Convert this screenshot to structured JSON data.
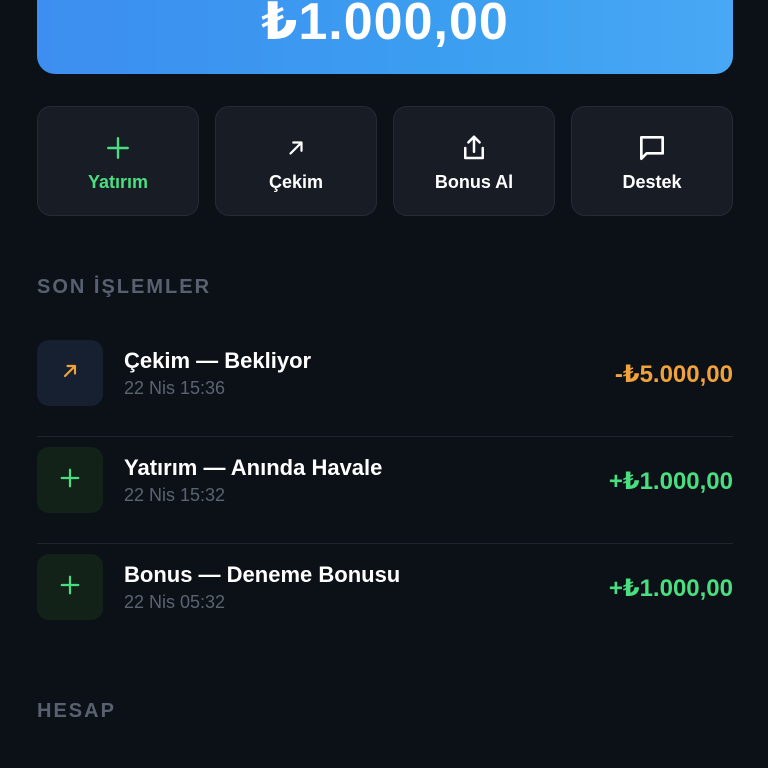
{
  "balance": {
    "amount": "₺1.000,00"
  },
  "actions": [
    {
      "label": "Yatırım",
      "icon": "plus-icon",
      "color": "#4ade80"
    },
    {
      "label": "Çekim",
      "icon": "arrow-up-right-icon",
      "color": "#ffffff"
    },
    {
      "label": "Bonus Al",
      "icon": "share-upload-icon",
      "color": "#ffffff"
    },
    {
      "label": "Destek",
      "icon": "chat-bubble-icon",
      "color": "#ffffff"
    }
  ],
  "recent": {
    "title": "SON İŞLEMLER",
    "items": [
      {
        "title": "Çekim — Bekliyor",
        "time": "22 Nis 15:36",
        "amount": "-₺5.000,00",
        "icon": "arrow-up-right-icon",
        "color": "#f0a23b"
      },
      {
        "title": "Yatırım — Anında Havale",
        "time": "22 Nis 15:32",
        "amount": "+₺1.000,00",
        "icon": "plus-icon",
        "color": "#4ade80"
      },
      {
        "title": "Bonus — Deneme Bonusu",
        "time": "22 Nis 05:32",
        "amount": "+₺1.000,00",
        "icon": "plus-icon",
        "color": "#4ade80"
      }
    ]
  },
  "account": {
    "title": "HESAP"
  }
}
